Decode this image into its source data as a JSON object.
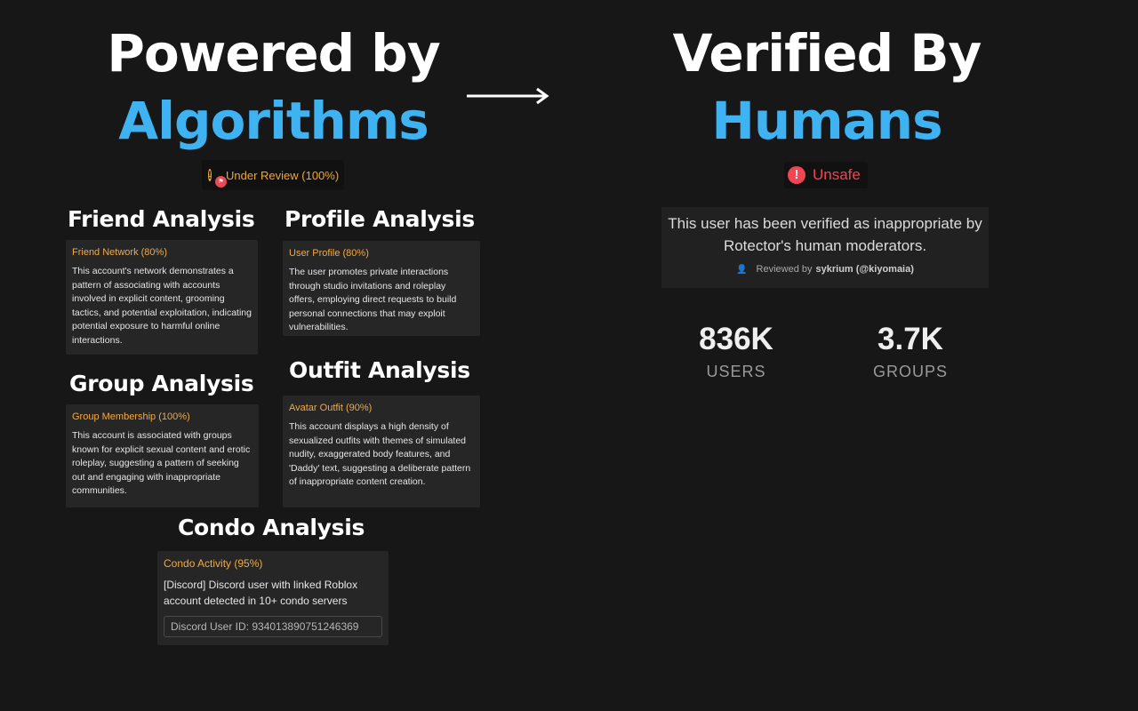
{
  "left_headline": {
    "line1": "Powered by",
    "line2": "Algorithms"
  },
  "right_headline": {
    "line1": "Verified By",
    "line2": "Humans"
  },
  "review_badge": {
    "label": "Under Review (100%)",
    "icon": "warning-icon",
    "color": "#f3a62c"
  },
  "unsafe_badge": {
    "label": "Unsafe",
    "icon": "alert-icon",
    "color": "#f04552"
  },
  "sections": {
    "friend": {
      "title": "Friend Analysis",
      "card_title": "Friend Network (80%)",
      "card_text": "This account's network demonstrates a pattern of associating with accounts involved in explicit content, grooming tactics, and potential exploitation, indicating potential exposure to harmful online interactions."
    },
    "profile": {
      "title": "Profile Analysis",
      "card_title": "User Profile (80%)",
      "card_text": "The user promotes private interactions through studio invitations and roleplay offers, employing direct requests to build personal connections that may exploit vulnerabilities."
    },
    "group": {
      "title": "Group Analysis",
      "card_title": "Group Membership (100%)",
      "card_text": "This account is associated with groups known for explicit sexual content and erotic roleplay, suggesting a pattern of seeking out and engaging with inappropriate communities."
    },
    "outfit": {
      "title": "Outfit Analysis",
      "card_title": "Avatar Outfit (90%)",
      "card_text": "This account displays a high density of sexualized outfits with themes of simulated nudity, exaggerated body features, and 'Daddy' text, suggesting a deliberate pattern of inappropriate content creation."
    },
    "condo": {
      "title": "Condo Analysis",
      "card_title": "Condo Activity (95%)",
      "card_text": "[Discord] Discord user with linked Roblox account detected in 10+ condo servers",
      "id_field": "Discord User ID: 934013890751246369"
    }
  },
  "verify_panel": {
    "text": "This user has been verified as inappropriate by Rotector's human moderators.",
    "reviewed_prefix": "Reviewed by",
    "reviewer": "sykrium (@kiyomaia)"
  },
  "stats": {
    "users": {
      "value": "836K",
      "label": "USERS"
    },
    "groups": {
      "value": "3.7K",
      "label": "GROUPS"
    }
  },
  "colors": {
    "accent": "#3fb2f2",
    "background": "#171717",
    "card": "#262626"
  }
}
